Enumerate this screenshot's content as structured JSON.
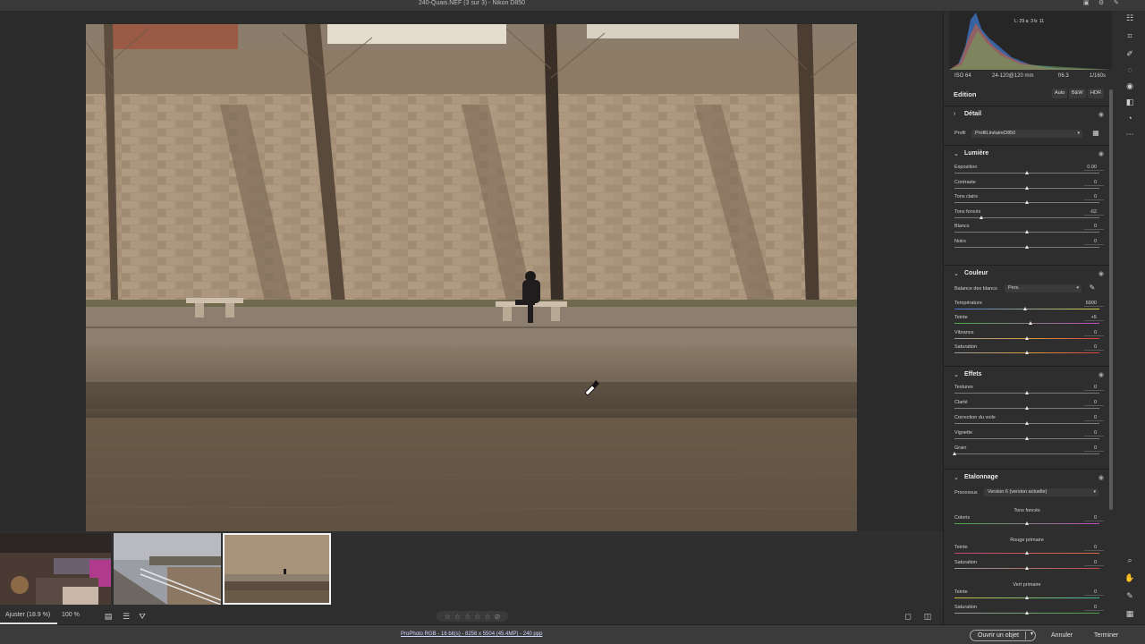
{
  "window": {
    "title": "240-Quais.NEF (3 sur 3) - Nikon D850"
  },
  "histogram": {
    "readout": "L: 29   a: 3   b: 11"
  },
  "exif": {
    "iso": "ISO 64",
    "lens": "24-120@120 mm",
    "aperture": "f/6.3",
    "shutter": "1/160s"
  },
  "edit": {
    "title": "Edition",
    "modes": [
      "Auto",
      "B&W",
      "HDR"
    ]
  },
  "sections": {
    "detail": {
      "title": "Détail"
    },
    "profile": {
      "label": "Profil",
      "value": "ProfilLinéaireD850"
    },
    "light": {
      "title": "Lumière",
      "rows": [
        {
          "label": "Exposition",
          "value": "0.00",
          "level": 0.5
        },
        {
          "label": "Contraste",
          "value": "0",
          "level": 0.5
        },
        {
          "label": "Tons clairs",
          "value": "0",
          "level": 0.5
        },
        {
          "label": "Tons foncés",
          "value": "-62",
          "level": 0.19
        },
        {
          "label": "Blancs",
          "value": "0",
          "level": 0.5
        },
        {
          "label": "Noirs",
          "value": "0",
          "level": 0.5
        }
      ]
    },
    "color": {
      "title": "Couleur",
      "wb_label": "Balance des blancs",
      "wb_value": "Pers.",
      "rows": [
        {
          "label": "Température",
          "value": "6900",
          "level": 0.49
        },
        {
          "label": "Teinte",
          "value": "+5",
          "level": 0.53
        },
        {
          "label": "Vibrance",
          "value": "0",
          "level": 0.5
        },
        {
          "label": "Saturation",
          "value": "0",
          "level": 0.5
        }
      ]
    },
    "effects": {
      "title": "Effets",
      "rows": [
        {
          "label": "Textures",
          "value": "0",
          "level": 0.5
        },
        {
          "label": "Clarté",
          "value": "0",
          "level": 0.5
        },
        {
          "label": "Correction du voile",
          "value": "0",
          "level": 0.5
        },
        {
          "label": "Vignette",
          "value": "0",
          "level": 0.5
        },
        {
          "label": "Grain",
          "value": "0",
          "level": 0.0
        }
      ]
    },
    "grading": {
      "title": "Etalonnage",
      "process_label": "Processus",
      "process_value": "Version 6 (version actuelle)",
      "groups": [
        {
          "heading": "Tons foncés",
          "rows": [
            {
              "label": "Coloris",
              "value": "0",
              "level": 0.5
            }
          ]
        },
        {
          "heading": "Rouge primaire",
          "rows": [
            {
              "label": "Teinte",
              "value": "0",
              "level": 0.5
            },
            {
              "label": "Saturation",
              "value": "0",
              "level": 0.5
            }
          ]
        },
        {
          "heading": "Vert primaire",
          "rows": [
            {
              "label": "Teinte",
              "value": "0",
              "level": 0.5
            },
            {
              "label": "Saturation",
              "value": "0",
              "level": 0.5
            }
          ]
        }
      ]
    }
  },
  "bottom": {
    "zoom_fit": "Ajuster (18.9 %)",
    "zoom_100": "100 %",
    "stars": [
      "☆",
      "☆",
      "☆",
      "☆",
      "☆",
      "⊘"
    ]
  },
  "status": {
    "color_info": "ProPhoto RGB - 16 bit(s) - 8256 x 5504 (45.4MP) - 240 ppp",
    "open_object": "Ouvrir un objet",
    "cancel": "Annuler",
    "done": "Terminer"
  },
  "colors": {
    "accent": "#e6e6e6",
    "panel_bg": "#2e2e2e",
    "workspace_bg": "#2b2b2b"
  },
  "icons": {
    "toolbar": [
      "edit-sliders-icon",
      "crop-icon",
      "healing-brush-icon",
      "masking-icon",
      "redeye-icon",
      "presets-icon",
      "snapshots-icon",
      "more-icon",
      "zoom-icon",
      "hand-icon",
      "color-sampler-icon",
      "grid-icon"
    ]
  }
}
